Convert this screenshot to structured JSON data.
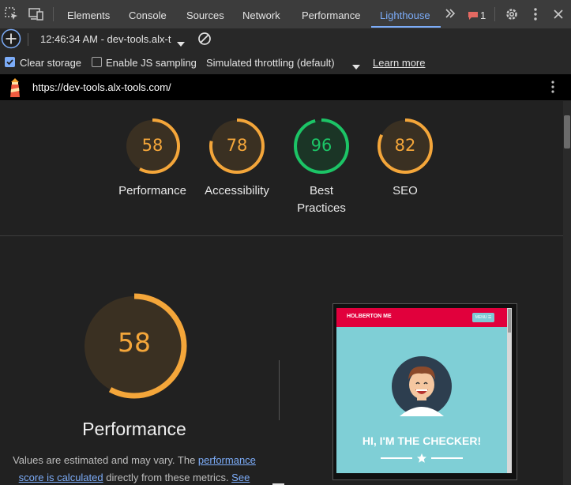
{
  "tabs": [
    {
      "label": "Elements"
    },
    {
      "label": "Console"
    },
    {
      "label": "Sources"
    },
    {
      "label": "Network"
    },
    {
      "label": "Performance"
    },
    {
      "label": "Lighthouse"
    }
  ],
  "issues_count": "1",
  "toolbar": {
    "report_label": "12:46:34 AM - dev-tools.alx-t"
  },
  "options": {
    "clear_storage": "Clear storage",
    "js_sampling": "Enable JS sampling",
    "throttling": "Simulated throttling (default)",
    "learn_more": "Learn more"
  },
  "url": "https://dev-tools.alx-tools.com/",
  "gauges": [
    {
      "score": "58",
      "label": "Performance",
      "value": 0.58,
      "color": "#f4a63a"
    },
    {
      "score": "78",
      "label": "Accessibility",
      "value": 0.78,
      "color": "#f4a63a"
    },
    {
      "score": "96",
      "label": "Best Practices",
      "value": 0.96,
      "color": "#1cc466"
    },
    {
      "score": "82",
      "label": "SEO",
      "value": 0.82,
      "color": "#f4a63a"
    }
  ],
  "best_label_1": "Best",
  "best_label_2": "Practices",
  "main": {
    "score": "58",
    "value": 0.58,
    "title": "Performance",
    "desc_1": "Values are estimated and may vary. The ",
    "desc_link_1": "performance",
    "desc_link_2": "score is calculated",
    "desc_2": " directly from these metrics. ",
    "desc_link_3": "See"
  },
  "screenshot": {
    "brand": "HOLBERTON ME",
    "menu": "MENU ☰",
    "headline": "HI, I'M THE CHECKER!"
  }
}
